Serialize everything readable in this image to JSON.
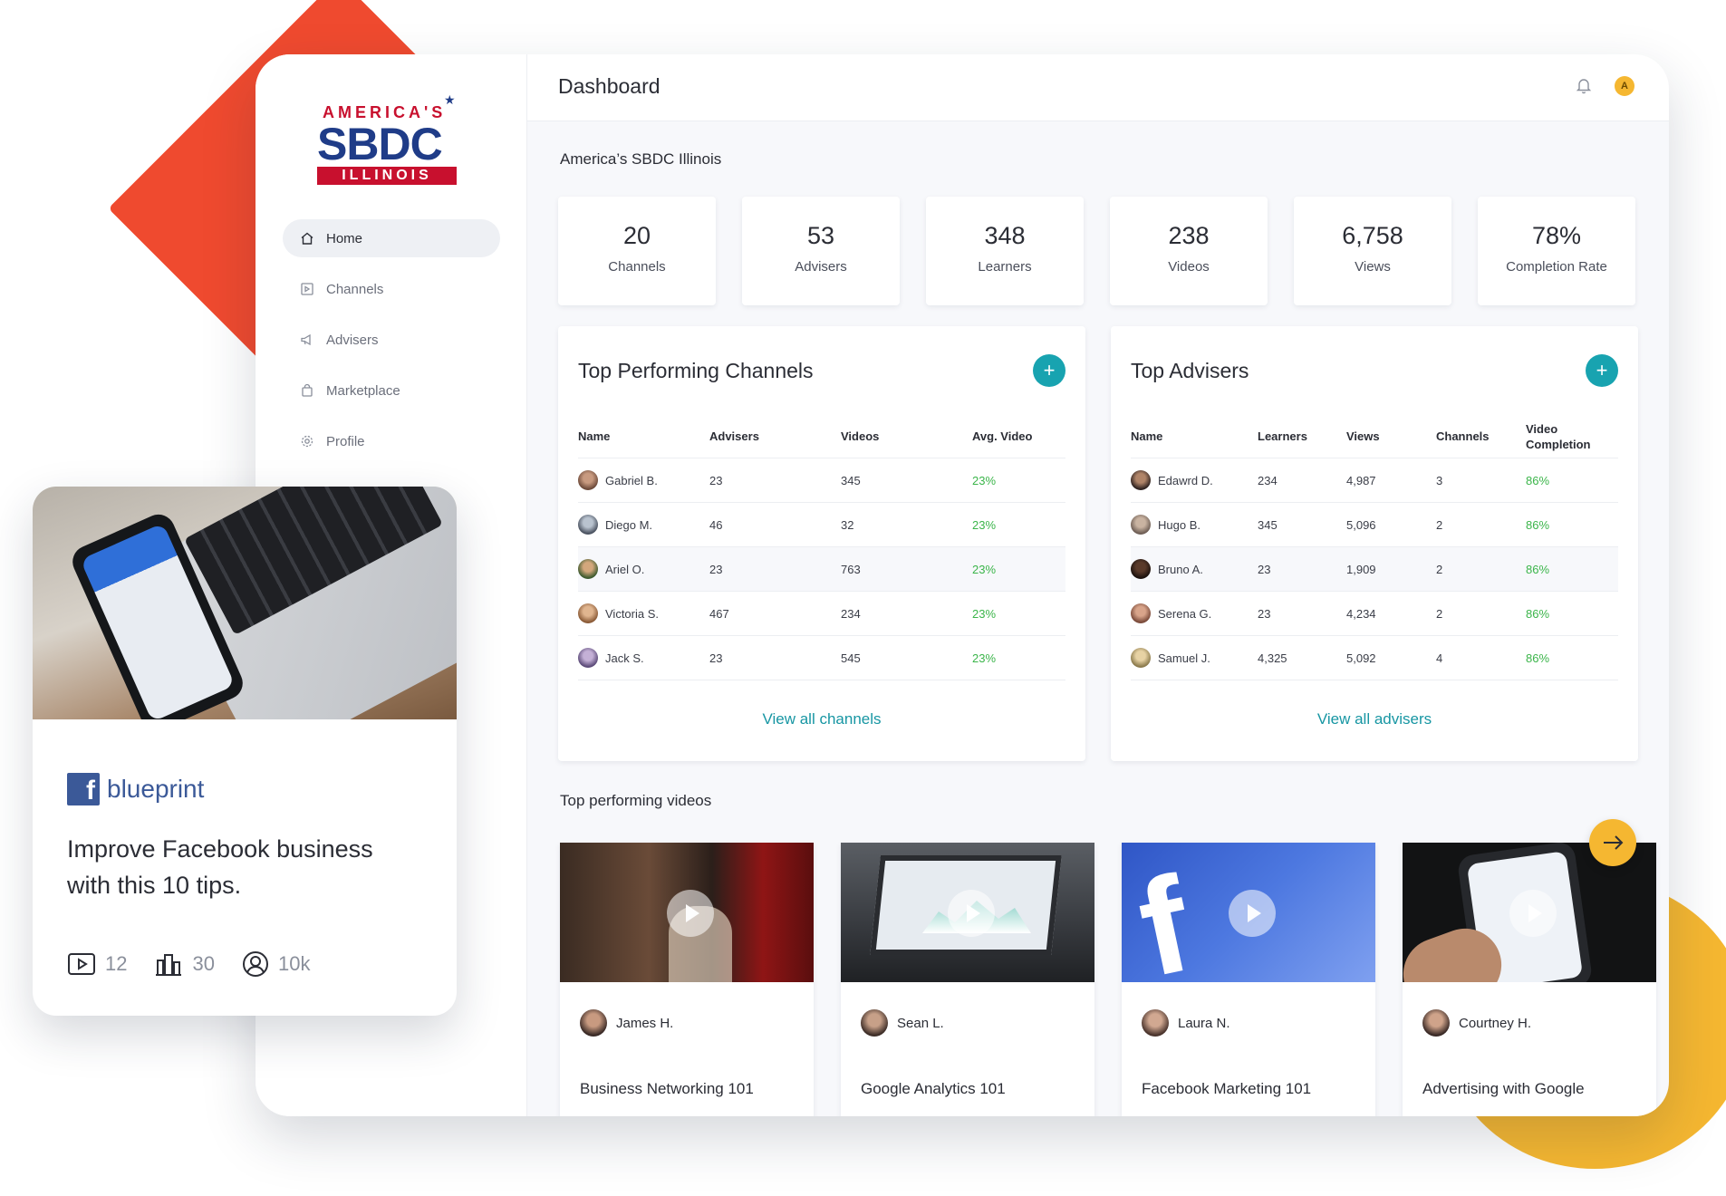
{
  "topbar": {
    "title": "Dashboard",
    "avatar_initial": "A"
  },
  "logo": {
    "line1": "AMERICA'S",
    "line2": "SBDC",
    "line3": "ILLINOIS"
  },
  "sidebar": {
    "items": [
      {
        "label": "Home",
        "icon": "home-icon",
        "active": true
      },
      {
        "label": "Channels",
        "icon": "channels-icon",
        "active": false
      },
      {
        "label": "Advisers",
        "icon": "megaphone-icon",
        "active": false
      },
      {
        "label": "Marketplace",
        "icon": "shopping-bag-icon",
        "active": false
      },
      {
        "label": "Profile",
        "icon": "gear-icon",
        "active": false
      }
    ]
  },
  "org_name": "America’s SBDC Illinois",
  "stats": [
    {
      "value": "20",
      "label": "Channels"
    },
    {
      "value": "53",
      "label": "Advisers"
    },
    {
      "value": "348",
      "label": "Learners"
    },
    {
      "value": "238",
      "label": "Videos"
    },
    {
      "value": "6,758",
      "label": "Views"
    },
    {
      "value": "78%",
      "label": "Completion Rate"
    }
  ],
  "channels_panel": {
    "title": "Top Performing Channels",
    "columns": [
      "Name",
      "Advisers",
      "Videos",
      "Avg. Video"
    ],
    "rows": [
      {
        "name": "Gabriel B.",
        "advisers": "23",
        "videos": "345",
        "avg": "23%"
      },
      {
        "name": "Diego M.",
        "advisers": "46",
        "videos": "32",
        "avg": "23%"
      },
      {
        "name": "Ariel O.",
        "advisers": "23",
        "videos": "763",
        "avg": "23%"
      },
      {
        "name": "Victoria S.",
        "advisers": "467",
        "videos": "234",
        "avg": "23%"
      },
      {
        "name": "Jack S.",
        "advisers": "23",
        "videos": "545",
        "avg": "23%"
      }
    ],
    "view_all": "View all channels"
  },
  "advisers_panel": {
    "title": "Top Advisers",
    "columns": [
      "Name",
      "Learners",
      "Views",
      "Channels",
      "Video Completion"
    ],
    "rows": [
      {
        "name": "Edawrd D.",
        "learners": "234",
        "views": "4,987",
        "channels": "3",
        "completion": "86%"
      },
      {
        "name": "Hugo B.",
        "learners": "345",
        "views": "5,096",
        "channels": "2",
        "completion": "86%"
      },
      {
        "name": "Bruno A.",
        "learners": "23",
        "views": "1,909",
        "channels": "2",
        "completion": "86%"
      },
      {
        "name": "Serena G.",
        "learners": "23",
        "views": "4,234",
        "channels": "2",
        "completion": "86%"
      },
      {
        "name": "Samuel J.",
        "learners": "4,325",
        "views": "5,092",
        "channels": "4",
        "completion": "86%"
      }
    ],
    "view_all": "View all advisers"
  },
  "videos_section": {
    "title": "Top performing videos",
    "videos": [
      {
        "author": "James H.",
        "title": "Business Networking 101"
      },
      {
        "author": "Sean L.",
        "title": "Google Analytics 101"
      },
      {
        "author": "Laura  N.",
        "title": "Facebook Marketing 101"
      },
      {
        "author": "Courtney H.",
        "title": "Advertising with Google"
      }
    ]
  },
  "blueprint_card": {
    "brand": "blueprint",
    "headline": "Improve Facebook business with this 10 tips.",
    "videos_count": "12",
    "channels_count": "30",
    "learners_count": "10k"
  },
  "colors": {
    "accent_teal": "#18a3b0",
    "link_teal": "#1796a3",
    "success_green": "#3bb54a",
    "deco_red": "#ef4a2f",
    "deco_yellow": "#f5b731",
    "facebook_blue": "#3b5998"
  }
}
